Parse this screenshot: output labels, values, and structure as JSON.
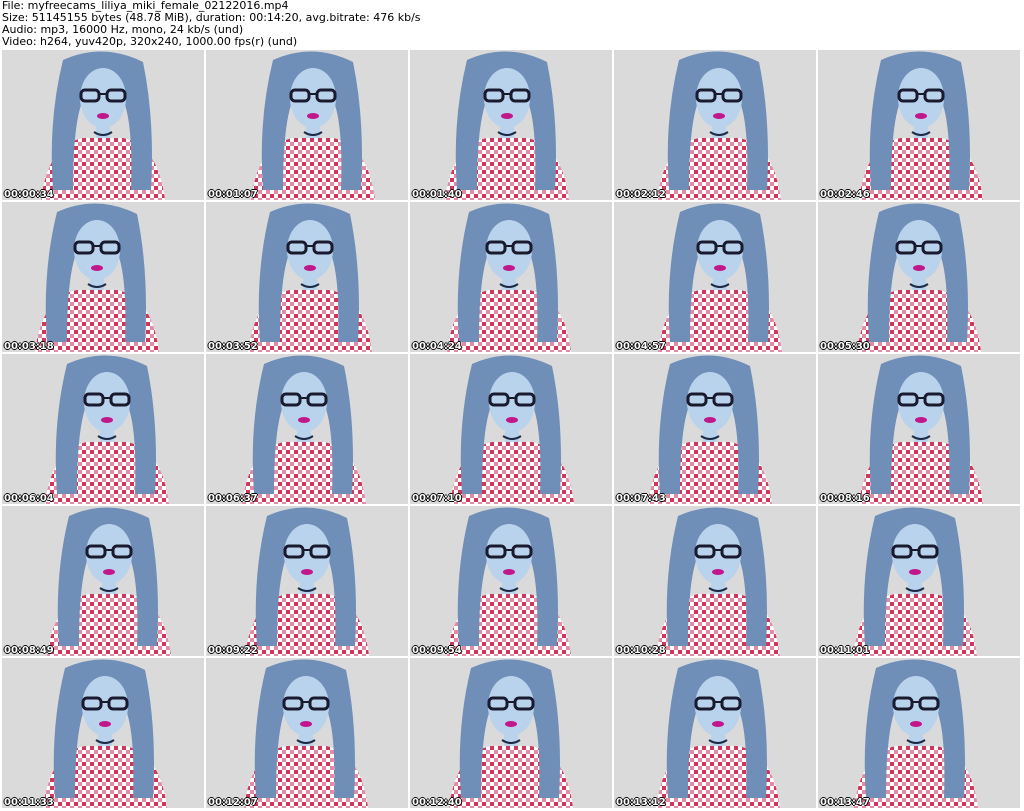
{
  "header": {
    "file": "File: myfreecams_liliya_miki_female_02122016.mp4",
    "size": "Size: 51145155 bytes (48.78 MiB), duration: 00:14:20, avg.bitrate: 476 kb/s",
    "audio": "Audio: mp3, 16000 Hz, mono, 24 kb/s (und)",
    "video": "Video: h264, yuv420p, 320x240, 1000.00 fps(r) (und)"
  },
  "thumbnails": [
    {
      "time": "00:00:34",
      "icon": "video-frame"
    },
    {
      "time": "00:01:07",
      "icon": "video-frame"
    },
    {
      "time": "00:01:40",
      "icon": "video-frame"
    },
    {
      "time": "00:02:12",
      "icon": "video-frame"
    },
    {
      "time": "00:02:46",
      "icon": "video-frame"
    },
    {
      "time": "00:03:18",
      "icon": "video-frame"
    },
    {
      "time": "00:03:52",
      "icon": "video-frame"
    },
    {
      "time": "00:04:24",
      "icon": "video-frame"
    },
    {
      "time": "00:04:57",
      "icon": "video-frame"
    },
    {
      "time": "00:05:30",
      "icon": "video-frame"
    },
    {
      "time": "00:06:04",
      "icon": "video-frame"
    },
    {
      "time": "00:06:37",
      "icon": "video-frame"
    },
    {
      "time": "00:07:10",
      "icon": "video-frame"
    },
    {
      "time": "00:07:43",
      "icon": "video-frame"
    },
    {
      "time": "00:08:16",
      "icon": "video-frame"
    },
    {
      "time": "00:08:49",
      "icon": "video-frame"
    },
    {
      "time": "00:09:22",
      "icon": "video-frame"
    },
    {
      "time": "00:09:54",
      "icon": "video-frame"
    },
    {
      "time": "00:10:28",
      "icon": "video-frame"
    },
    {
      "time": "00:11:01",
      "icon": "video-frame"
    },
    {
      "time": "00:11:33",
      "icon": "video-frame"
    },
    {
      "time": "00:12:07",
      "icon": "video-frame"
    },
    {
      "time": "00:12:40",
      "icon": "video-frame"
    },
    {
      "time": "00:13:12",
      "icon": "video-frame"
    },
    {
      "time": "00:13:47",
      "icon": "video-frame"
    }
  ],
  "colors": {
    "background": "#dadada",
    "hair": "#6f8fb8",
    "skin": "#b9d3ec",
    "shirt_red": "#d2345a",
    "shirt_white": "#ffffff",
    "glasses": "#1a1a2e",
    "lips": "#c2178a"
  }
}
